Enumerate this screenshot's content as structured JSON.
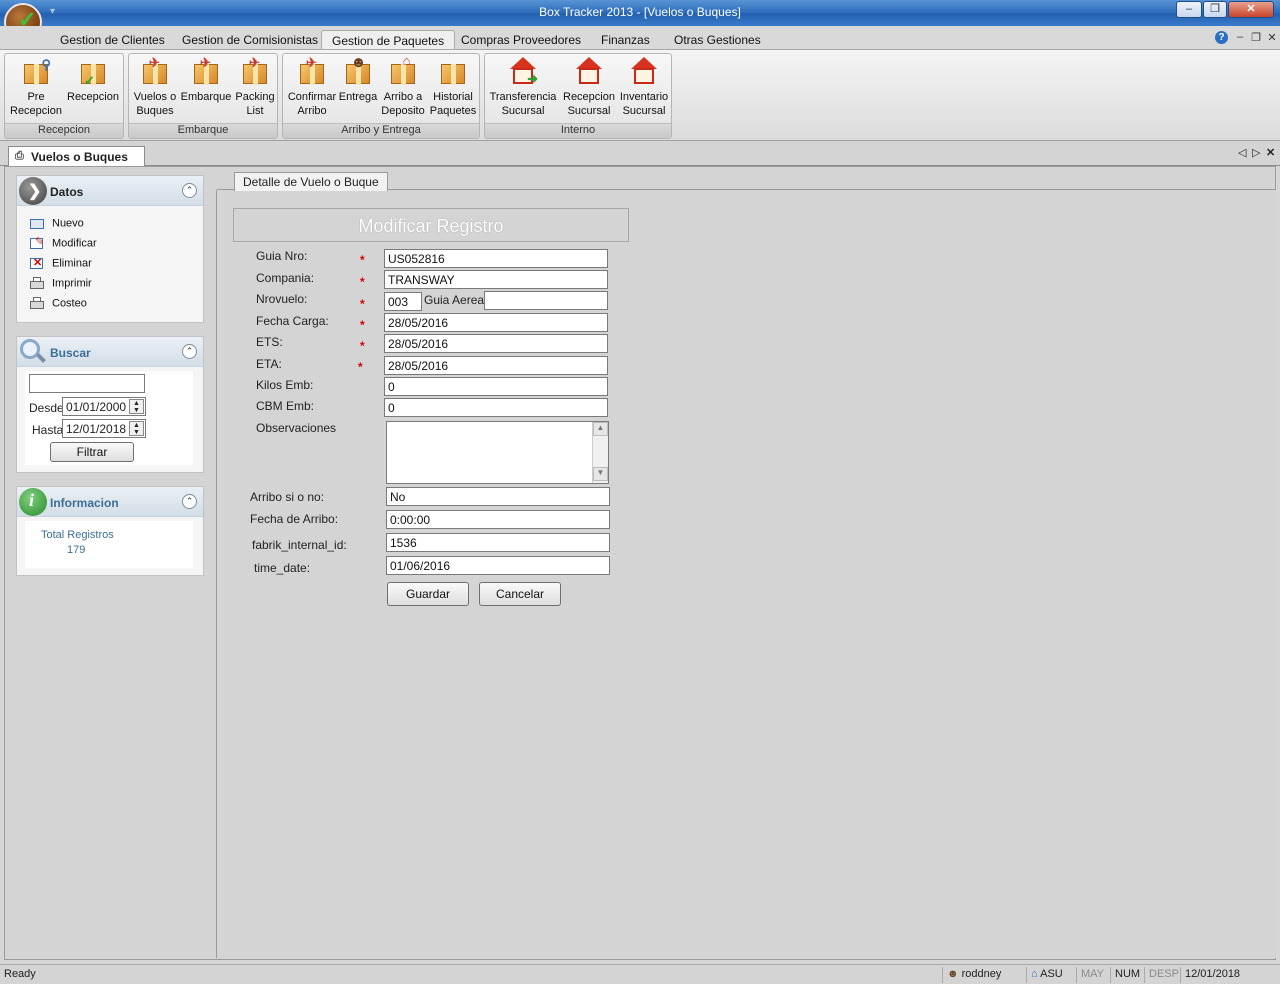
{
  "window": {
    "title": "Box Tracker 2013 - [Vuelos o Buques]",
    "quick_access": "▾",
    "minimize": "–",
    "restore": "❐",
    "close": "✕"
  },
  "ribbon_tabs": [
    "Gestion de Clientes",
    "Gestion de Comisionistas",
    "Gestion de Paquetes",
    "Compras  Proveedores",
    "Finanzas",
    "Otras Gestiones"
  ],
  "ribbon_tab_controls": {
    "help": "?",
    "minimize": "–",
    "restore": "❐",
    "close": "✕"
  },
  "ribbon_groups": [
    {
      "label": "Recepcion",
      "buttons": [
        {
          "line1": "Pre",
          "line2": "Recepcion",
          "icon": "box-search-icon"
        },
        {
          "line1": "Recepcion",
          "line2": "",
          "icon": "box-check-icon"
        }
      ]
    },
    {
      "label": "Embarque",
      "buttons": [
        {
          "line1": "Vuelos o",
          "line2": "Buques",
          "icon": "plane-box-icon"
        },
        {
          "line1": "Embarque",
          "line2": "",
          "icon": "plane-box-icon"
        },
        {
          "line1": "Packing",
          "line2": "List",
          "icon": "box-list-icon"
        }
      ]
    },
    {
      "label": "Arribo y Entrega",
      "buttons": [
        {
          "line1": "Confirmar",
          "line2": "Arribo",
          "icon": "plane-box-icon"
        },
        {
          "line1": "Entrega",
          "line2": "",
          "icon": "person-box-icon"
        },
        {
          "line1": "Arribo a",
          "line2": "Deposito",
          "icon": "house-box-icon"
        },
        {
          "line1": "Historial",
          "line2": "Paquetes",
          "icon": "box-history-icon"
        }
      ]
    },
    {
      "label": "Interno",
      "buttons": [
        {
          "line1": "Transferencia",
          "line2": "Sucursal",
          "icon": "house-transfer-icon"
        },
        {
          "line1": "Recepcion",
          "line2": "Sucursal",
          "icon": "house-receive-icon"
        },
        {
          "line1": "Inventario",
          "line2": "Sucursal",
          "icon": "house-inventory-icon"
        }
      ]
    }
  ],
  "document_tab": {
    "label": "Vuelos o Buques",
    "nav_prev": "◁",
    "nav_next": "▷",
    "nav_close": "✕"
  },
  "datos_panel": {
    "title": "Datos",
    "items": [
      "Nuevo",
      "Modificar",
      "Eliminar",
      "Imprimir",
      "Costeo"
    ]
  },
  "buscar_panel": {
    "title": "Buscar",
    "search_value": "",
    "desde_label": "Desde",
    "desde_value": "01/01/2000",
    "hasta_label": "Hasta",
    "hasta_value": "12/01/2018",
    "filter_button": "Filtrar"
  },
  "info_panel": {
    "title": "Informacion",
    "total_label": "Total Registros",
    "total_value": "179"
  },
  "detail_tab": "Detalle de Vuelo o Buque",
  "form": {
    "title": "Modificar Registro",
    "guia_nro_label": "Guia Nro:",
    "guia_nro": "US052816",
    "compania_label": "Compania:",
    "compania": "TRANSWAY",
    "nrovuelo_label": "Nrovuelo:",
    "nrovuelo": "003",
    "guia_aerea_label": "Guia Aerea",
    "guia_aerea": "",
    "fecha_carga_label": "Fecha Carga:",
    "fecha_carga": "28/05/2016",
    "ets_label": "ETS:",
    "ets": "28/05/2016",
    "eta_label": "ETA:",
    "eta": "28/05/2016",
    "kilos_label": "Kilos Emb:",
    "kilos": "0",
    "cbm_label": "CBM Emb:",
    "cbm": "0",
    "obs_label": "Observaciones",
    "obs": "",
    "arribo_label": "Arribo  si o no:",
    "arribo": "No",
    "fecha_arribo_label": "Fecha de Arribo:",
    "fecha_arribo": "0:00:00",
    "fabrik_label": "fabrik_internal_id:",
    "fabrik": "1536",
    "time_date_label": "time_date:",
    "time_date": "01/06/2016",
    "required_mark": "*",
    "save_button": "Guardar",
    "cancel_button": "Cancelar"
  },
  "status_bar": {
    "status": "Ready",
    "user": "roddney",
    "branch": "ASU",
    "caps": "MAY",
    "num": "NUM",
    "scroll": "DESP",
    "date": "12/01/2018"
  },
  "colors": {
    "title_bar": "#2f6fbd",
    "panel_title": "#3d6e96",
    "required": "#d40000",
    "status_disabled": "#8a8a8a"
  }
}
